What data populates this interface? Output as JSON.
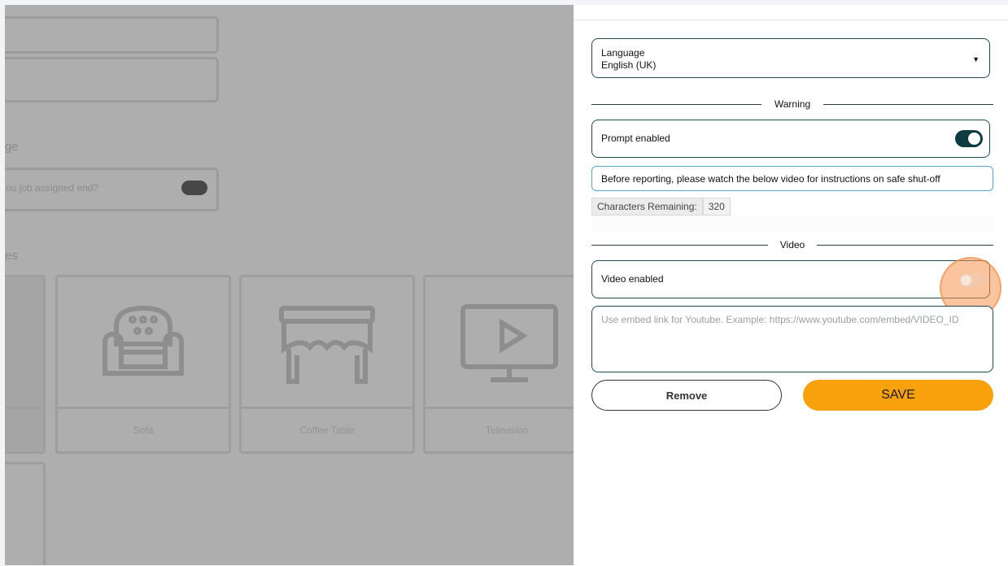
{
  "background": {
    "section_labels": [
      "ge",
      "es"
    ],
    "toggle_question": "ou job assigned end?",
    "cards": [
      {
        "caption": "Sofa",
        "icon": "armchair-icon"
      },
      {
        "caption": "Coffee Table",
        "icon": "table-icon"
      },
      {
        "caption": "Television",
        "icon": "tv-icon"
      }
    ]
  },
  "panel": {
    "language": {
      "label": "Language",
      "value": "English (UK)"
    },
    "warning_divider": "Warning",
    "prompt": {
      "label": "Prompt enabled",
      "enabled": true
    },
    "prompt_text": "Before reporting, please watch the below video for instructions on safe shut-off",
    "counter": {
      "label": "Characters Remaining:",
      "value": "320"
    },
    "video_divider": "Video",
    "video": {
      "label": "Video enabled",
      "enabled": false
    },
    "video_url": {
      "value": "",
      "placeholder": "Use embed link for Youtube. Example: https://www.youtube.com/embed/VIDEO_ID"
    },
    "buttons": {
      "remove": "Remove",
      "save": "SAVE"
    }
  },
  "colors": {
    "accent": "#f8a10c",
    "toggle_on": "#0e3b42",
    "highlight": "#f4934e"
  }
}
